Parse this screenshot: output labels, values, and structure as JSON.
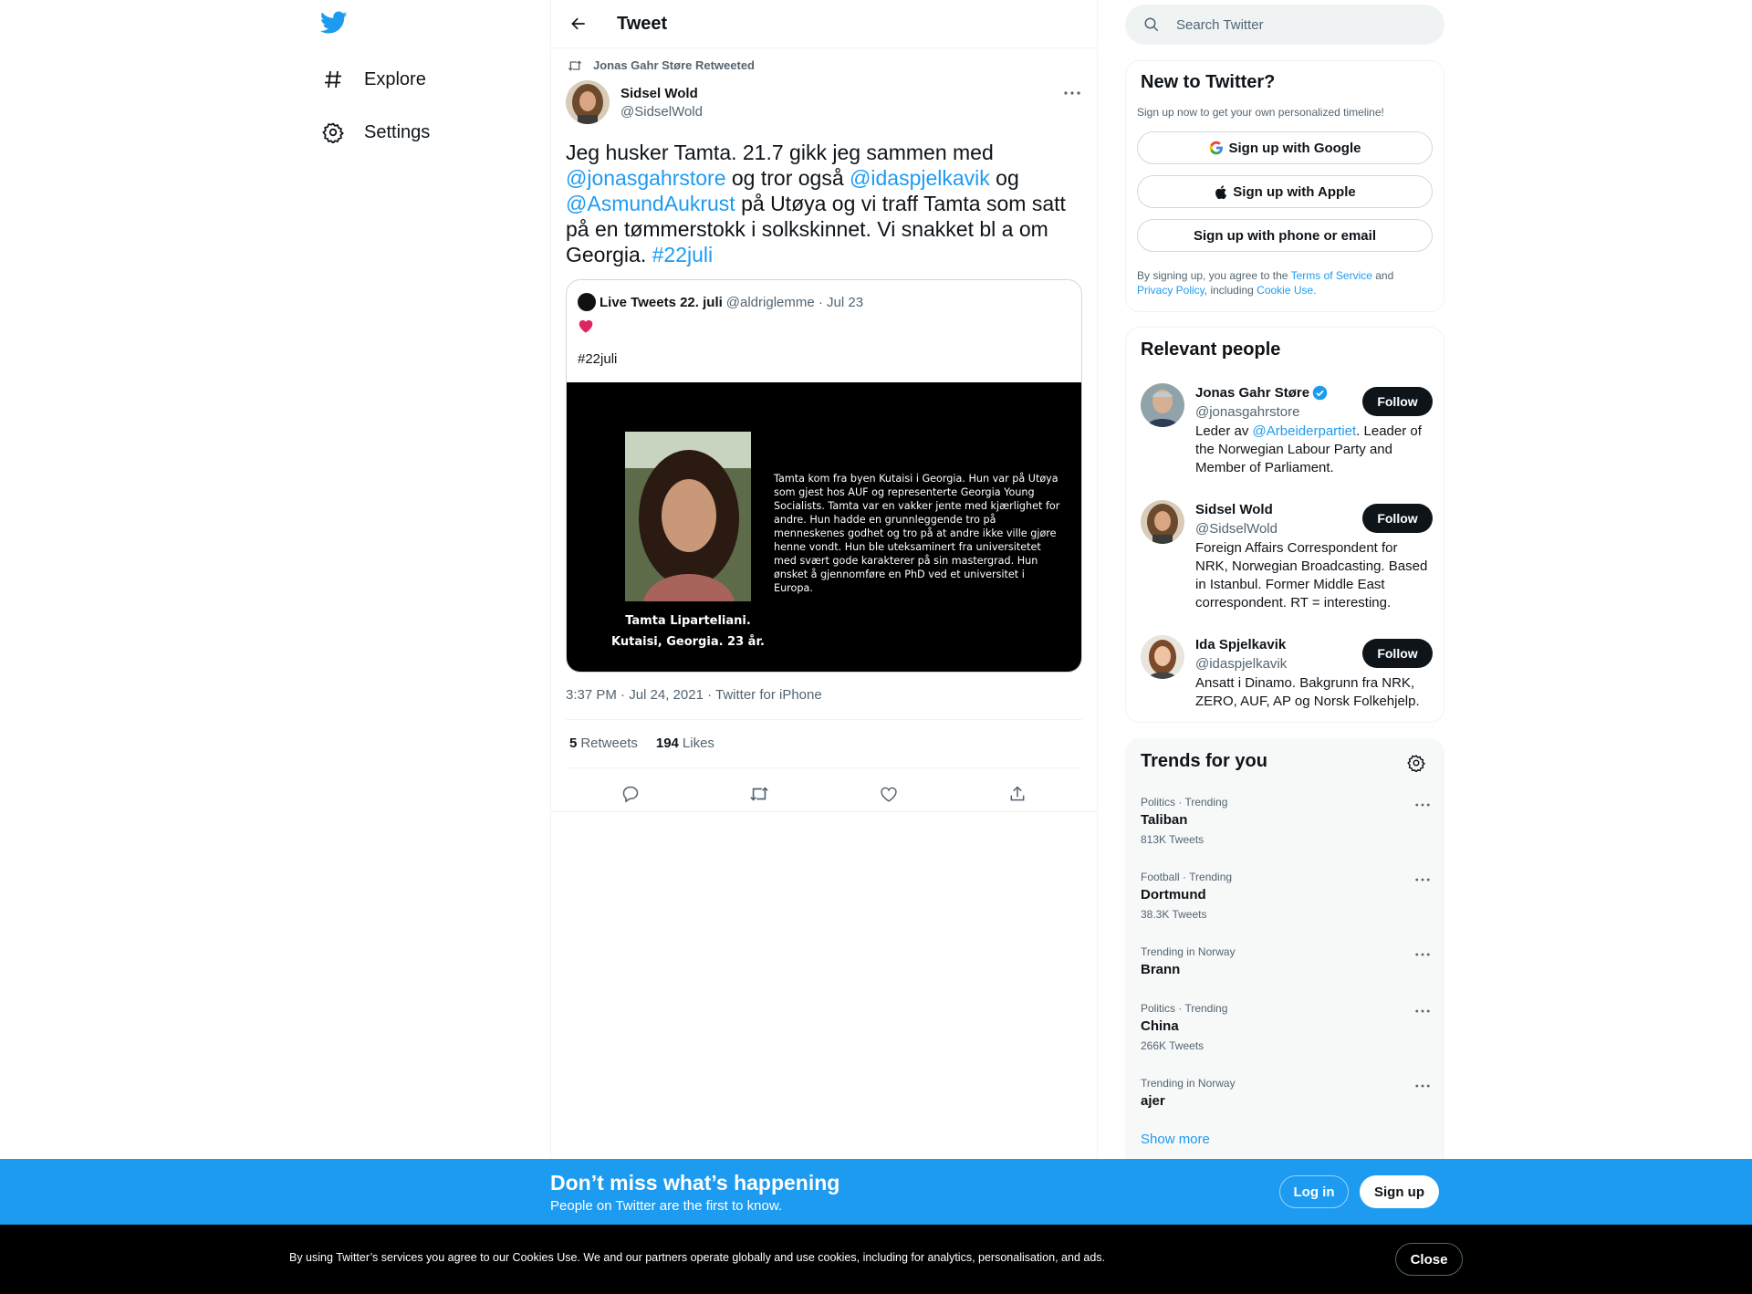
{
  "nav": {
    "explore_label": "Explore",
    "settings_label": "Settings"
  },
  "header": {
    "title": "Tweet"
  },
  "tweet": {
    "retweeted_by": "Jonas Gahr Støre Retweeted",
    "author_name": "Sidsel Wold",
    "author_handle": "@SidselWold",
    "text_parts": {
      "p1": "Jeg husker Tamta. 21.7 gikk jeg sammen med ",
      "m1": "@jonasgahrstore",
      "p2": " og tror også  ",
      "m2": "@idaspjelkavik",
      "p3": "  og ",
      "m3": "@AsmundAukrust",
      "p4": " på Utøya og vi traff Tamta som satt på en tømmerstokk i solkskinnet. Vi snakket bl a om Georgia. ",
      "h1": "#22juli"
    },
    "quote": {
      "name": "Live Tweets 22. juli",
      "handle_date": "@aldriglemme · Jul 23",
      "hashtag": "#22juli",
      "image_text": "Tamta kom fra byen Kutaisi i Georgia. Hun var på Utøya som gjest hos AUF og representerte Georgia Young Socialists. Tamta var en vakker jente med kjærlighet for andre. Hun hadde en grunnleggende tro på menneskenes godhet og tro på at andre ikke ville gjøre henne vondt. Hun ble uteksaminert fra universitetet med svært gode karakterer på sin mastergrad. Hun ønsket å gjennomføre en PhD ved et universitet i Europa.",
      "image_caption_1": "Tamta Liparteliani.",
      "image_caption_2": "Kutaisi, Georgia. 23 år."
    },
    "meta": "3:37 PM · Jul 24, 2021 · Twitter for iPhone",
    "retweets_count": "5",
    "retweets_label": "Retweets",
    "likes_count": "194",
    "likes_label": "Likes"
  },
  "search": {
    "placeholder": "Search Twitter"
  },
  "new_to_twitter": {
    "title": "New to Twitter?",
    "subtitle": "Sign up now to get your own personalized timeline!",
    "google_label": "Sign up with Google",
    "apple_label": "Sign up with Apple",
    "phone_label": "Sign up with phone or email",
    "terms_1": "By signing up, you agree to the ",
    "terms_link": "Terms of Service",
    "terms_2": " and ",
    "privacy_link": "Privacy Policy",
    "terms_3": ", including ",
    "cookie_link": "Cookie Use."
  },
  "relevant": {
    "title": "Relevant people",
    "follow_label": "Follow",
    "people": [
      {
        "name": "Jonas Gahr Støre",
        "handle": "@jonasgahrstore",
        "bio_1": "Leder av ",
        "bio_link": "@Arbeiderpartiet",
        "bio_2": ". Leader of the Norwegian Labour Party and Member of Parliament."
      },
      {
        "name": "Sidsel Wold",
        "handle": "@SidselWold",
        "bio": "Foreign Affairs Correspondent for NRK, Norwegian Broadcasting. Based in Istanbul. Former Middle East correspondent. RT = interesting."
      },
      {
        "name": "Ida Spjelkavik",
        "handle": "@idaspjelkavik",
        "bio": "Ansatt i Dinamo. Bakgrunn fra NRK, ZERO, AUF, AP og Norsk Folkehjelp."
      }
    ]
  },
  "trends": {
    "title": "Trends for you",
    "items": [
      {
        "category": "Politics · Trending",
        "name": "Taliban",
        "count": "813K Tweets"
      },
      {
        "category": "Football · Trending",
        "name": "Dortmund",
        "count": "38.3K Tweets"
      },
      {
        "category": "Trending in Norway",
        "name": "Brann",
        "count": ""
      },
      {
        "category": "Politics · Trending",
        "name": "China",
        "count": "266K Tweets"
      },
      {
        "category": "Trending in Norway",
        "name": "ajer",
        "count": ""
      }
    ],
    "show_more": "Show more"
  },
  "signup_bar": {
    "title": "Don’t miss what’s happening",
    "subtitle": "People on Twitter are the first to know.",
    "login_label": "Log in",
    "signup_label": "Sign up"
  },
  "cookie_bar": {
    "text": "By using Twitter’s services you agree to our Cookies Use. We and our partners operate globally and use cookies, including for analytics, personalisation, and ads.",
    "close_label": "Close"
  },
  "colors": {
    "accent": "#1d9bf0",
    "text": "#0f1419",
    "muted": "#536471",
    "heart": "#e0245e"
  }
}
